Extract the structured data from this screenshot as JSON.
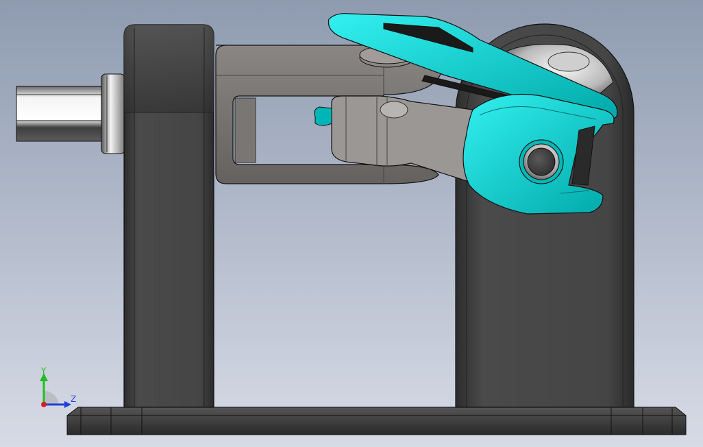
{
  "viewport": {
    "background_top": "#8e9bb0",
    "background_bottom": "#d7dbe6",
    "model_colors": {
      "dark_part": "#3a3a3a",
      "dark_part_mid": "#4a4a4a",
      "gray_part": "#6f6c6a",
      "gray_light": "#a6a29e",
      "cyan_part": "#00c9c9",
      "cyan_light": "#29e6e6",
      "cyan_dark": "#00a0a0",
      "shaft_light": "#e8e8e8",
      "shaft_dark": "#5a5a5a",
      "edge": "#111111"
    }
  },
  "triad": {
    "y_label": "Y",
    "z_label": "Z",
    "y_color": "#1fbf1f",
    "z_color": "#1f3fd8",
    "x_color": "#d81f1f"
  }
}
